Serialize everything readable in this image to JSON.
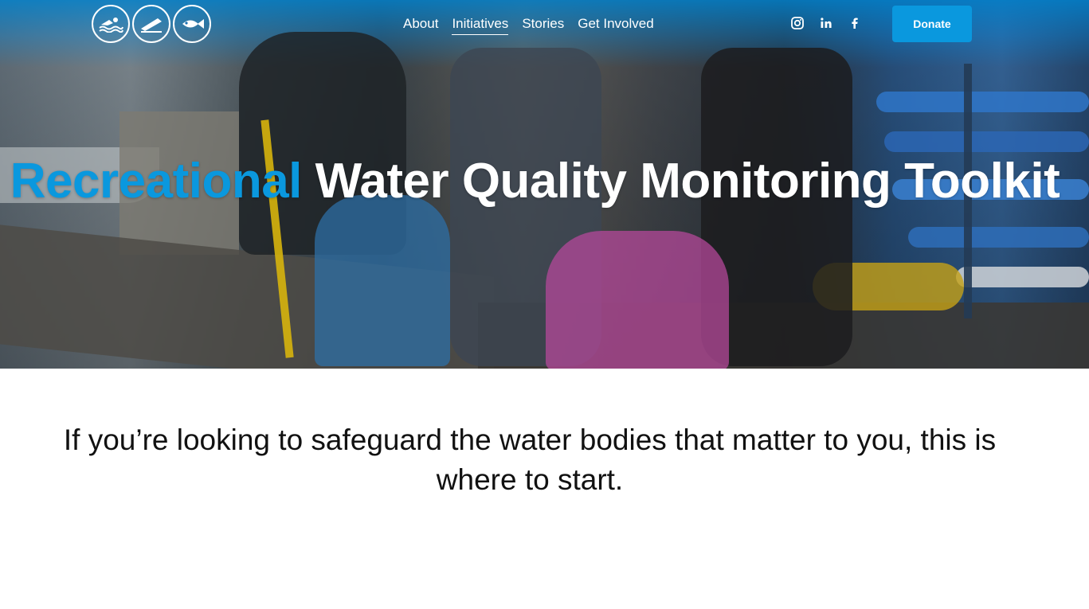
{
  "header": {
    "logos": [
      {
        "icon": "swimmer-icon"
      },
      {
        "icon": "surfboard-icon"
      },
      {
        "icon": "fish-icon"
      }
    ],
    "nav": [
      {
        "label": "About",
        "active": false
      },
      {
        "label": "Initiatives",
        "active": true
      },
      {
        "label": "Stories",
        "active": false
      },
      {
        "label": "Get Involved",
        "active": false
      }
    ],
    "social": [
      {
        "icon": "instagram-icon"
      },
      {
        "icon": "linkedin-icon",
        "label": "in"
      },
      {
        "icon": "facebook-icon",
        "label": "f"
      }
    ],
    "donate_label": "Donate"
  },
  "hero": {
    "title_accent": "Recreational",
    "title_rest": " Water Quality Monitoring Toolkit"
  },
  "intro": {
    "text": "If you’re looking to safeguard the water bodies that matter to you, this is where to start."
  },
  "colors": {
    "accent": "#0a98de",
    "text": "#111111",
    "background": "#ffffff"
  }
}
